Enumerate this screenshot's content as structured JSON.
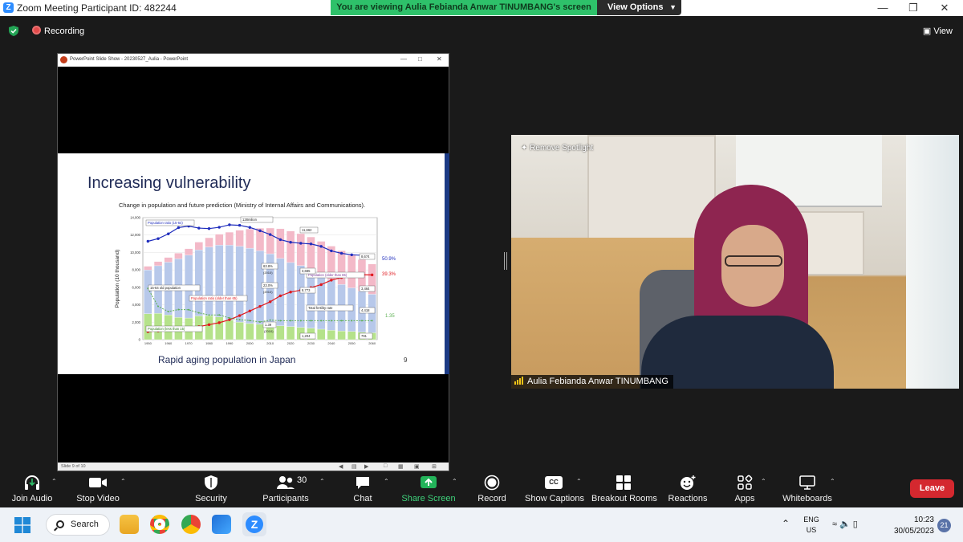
{
  "window": {
    "title": "Zoom Meeting Participant ID: 482244",
    "viewing_banner": "You are viewing Aulia Febianda Anwar TINUMBANG's screen",
    "view_options": "View Options"
  },
  "status": {
    "recording": "Recording",
    "view": "View"
  },
  "powerpoint": {
    "title": "PowerPoint Slide Show - 20230527_Aulia - PowerPoint",
    "status_text": "Slide 9 of 10"
  },
  "slide": {
    "title": "Increasing vulnerability",
    "subtitle": "Change in population and future prediction (Ministry of Internal Affairs and Communications).",
    "footer": "Rapid aging population in Japan",
    "page_number": "9"
  },
  "chart_data": {
    "type": "bar",
    "ylabel": "Population (10 thousand)",
    "ylim": [
      0,
      14000
    ],
    "y_ticks": [
      "14,000",
      "12,000",
      "10,000",
      "8,000",
      "6,000",
      "4,000",
      "2,000",
      "0"
    ],
    "x_ticks": [
      "1950",
      "1960",
      "1970",
      "1980",
      "1990",
      "2000",
      "2010",
      "2020",
      "2030",
      "2040",
      "2050",
      "2060"
    ],
    "categories": [
      "1950",
      "1955",
      "1960",
      "1965",
      "1970",
      "1975",
      "1980",
      "1985",
      "1990",
      "1995",
      "2000",
      "2005",
      "2010",
      "2015",
      "2020",
      "2025",
      "2030",
      "2035",
      "2040",
      "2045",
      "2050",
      "2055",
      "2060"
    ],
    "series": [
      {
        "name": "Population (less than 15)",
        "values": [
          2980,
          3010,
          2840,
          2550,
          2480,
          2720,
          2750,
          2600,
          2250,
          2000,
          1850,
          1760,
          1680,
          1590,
          1510,
          1410,
          1320,
          1200,
          1070,
          990,
          940,
          860,
          790
        ]
      },
      {
        "name": "15-64 old population",
        "values": [
          5020,
          5470,
          6050,
          6740,
          7210,
          7580,
          7880,
          8250,
          8590,
          8720,
          8640,
          8440,
          8170,
          7730,
          7340,
          7090,
          6770,
          6340,
          5790,
          5350,
          5000,
          4710,
          4420
        ]
      },
      {
        "name": "Population (older than 65)",
        "values": [
          420,
          480,
          540,
          630,
          740,
          890,
          1060,
          1250,
          1490,
          1830,
          2200,
          2580,
          2950,
          3400,
          3610,
          3660,
          3690,
          3740,
          3870,
          3860,
          3760,
          3620,
          3460
        ]
      },
      {
        "name": "Population ratio (15-64)",
        "values": [
          59.7,
          61.3,
          64.2,
          68.0,
          68.9,
          67.7,
          67.4,
          68.2,
          69.7,
          69.4,
          68.1,
          66.1,
          63.8,
          60.7,
          59.1,
          58.5,
          58.1,
          56.6,
          53.9,
          52.4,
          51.5,
          51.2,
          50.9
        ]
      },
      {
        "name": "Population ratio (older than 65)",
        "values": [
          4.9,
          5.3,
          5.7,
          6.3,
          7.1,
          7.9,
          9.1,
          10.3,
          12.1,
          14.6,
          17.4,
          20.2,
          23.0,
          26.6,
          28.9,
          30.0,
          31.6,
          33.4,
          36.1,
          37.7,
          38.8,
          39.4,
          39.3
        ]
      },
      {
        "name": "Total fertility rate",
        "values": [
          3.65,
          2.37,
          2.0,
          2.14,
          2.13,
          1.91,
          1.75,
          1.76,
          1.54,
          1.42,
          1.36,
          1.26,
          1.39,
          1.35,
          1.35,
          1.35,
          1.35,
          1.35,
          1.35,
          1.35,
          1.35,
          1.35,
          1.35
        ]
      }
    ],
    "labels": {
      "ratio_1564_box": "Population ratio (15-64)",
      "million_box": "128milion",
      "pop_1564_box": "15-64 old population",
      "ratio_65_box": "Population ratio (older than 65)",
      "older_box": "Population (older than 65)",
      "tfr_box": "Total fertility rate",
      "under15_box": "Population (less than 15)",
      "v_11662": "11,662",
      "v_8674": "8,674",
      "v_3685": "3,685",
      "v_8773": "8,773",
      "v_3464": "3,464",
      "v_4418": "4,418",
      "v_1204": "1,204",
      "v_791": "791",
      "v_638": "63.8%",
      "v_638_year": "(2010)",
      "v_230": "23.0%",
      "v_230_year": "(2010)",
      "v_139": "1.39",
      "v_139_year": "(2010)",
      "end_509": "50.9%",
      "end_393": "39.3%",
      "end_135": "1.35"
    },
    "colors": {
      "under15": "#b5e28a",
      "mid": "#b7c8ea",
      "older": "#f3b9c8",
      "ratio1564": "#1f2dbd",
      "ratio65": "#e0191e",
      "tfr": "#5fb155"
    }
  },
  "participant": {
    "spotlight": "Remove Spotlight",
    "name": "Aulia Febianda Anwar TINUMBANG"
  },
  "toolbar": {
    "join_audio": "Join Audio",
    "stop_video": "Stop Video",
    "security": "Security",
    "participants": "Participants",
    "participants_count": "30",
    "chat": "Chat",
    "share_screen": "Share Screen",
    "record": "Record",
    "show_captions": "Show Captions",
    "captions_icon_text": "CC",
    "breakout_rooms": "Breakout Rooms",
    "reactions": "Reactions",
    "apps": "Apps",
    "whiteboards": "Whiteboards",
    "leave": "Leave"
  },
  "taskbar": {
    "search": "Search",
    "lang_line1": "ENG",
    "lang_line2": "US",
    "time": "10:23",
    "date": "30/05/2023",
    "notifications": "21"
  }
}
